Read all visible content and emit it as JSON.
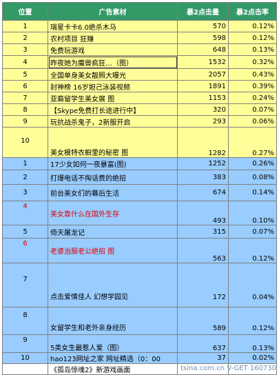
{
  "headers": [
    "位置",
    "广告素材",
    "暴2点击量",
    "暴2点击率"
  ],
  "rows": [
    {
      "pos": "1",
      "ad": "瑞星卡卡6.0绝杀木马",
      "clicks": "570",
      "rate": "0.12%",
      "group": "y"
    },
    {
      "pos": "2",
      "ad": "农村项目 狂赚",
      "clicks": "598",
      "rate": "0.12%",
      "group": "y"
    },
    {
      "pos": "3",
      "ad": "免费玩游戏",
      "clicks": "648",
      "rate": "0.13%",
      "group": "y"
    },
    {
      "pos": "4",
      "ad": "昨夜她为魔兽疯狂…（图）",
      "clicks": "1532",
      "rate": "0.32%",
      "group": "y"
    },
    {
      "pos": "5",
      "ad": "全国单身美女靓照大曝光",
      "clicks": "2057",
      "rate": "0.43%",
      "group": "y"
    },
    {
      "pos": "6",
      "ad": "封神榜 16岁妲己泳装视频",
      "clicks": "1891",
      "rate": "0.39%",
      "group": "y"
    },
    {
      "pos": "7",
      "ad": "亚裔留学生美女展 图",
      "clicks": "1153",
      "rate": "0.24%",
      "group": "y"
    },
    {
      "pos": "8",
      "ad": "【Skype免费打长途进行中】",
      "clicks": "320",
      "rate": "0.07%",
      "group": "y"
    },
    {
      "pos": "9",
      "ad": "玩抗战杀鬼子，2新服开启",
      "clicks": "293",
      "rate": "0.06%",
      "group": "y"
    },
    {
      "pos": "10",
      "ad": "美女模特衣橱里的秘密 图",
      "clicks": "1282",
      "rate": "0.27%",
      "group": "y"
    },
    {
      "pos": "1",
      "ad": "17少女如何一夜暴富(图)",
      "clicks": "1252",
      "rate": "0.26%",
      "group": "b"
    },
    {
      "pos": "2",
      "ad": "打爆电话不掏话费的绝招",
      "clicks": "383",
      "rate": "0.08%",
      "group": "b"
    },
    {
      "pos": "3",
      "ad": "前台美女们的幕后生活",
      "clicks": "674",
      "rate": "0.14%",
      "group": "b"
    },
    {
      "pos": "4",
      "ad": "美女靠什么在国外生存",
      "clicks": "493",
      "rate": "0.10%",
      "group": "b"
    },
    {
      "pos": "5",
      "ad": "倚天屠龙记",
      "clicks": "315",
      "rate": "0.07%",
      "group": "b"
    },
    {
      "pos": "6",
      "ad": "老婆治服老公绝招 图",
      "clicks": "563",
      "rate": "0.12%",
      "group": "b"
    },
    {
      "pos": "7",
      "ad": "点击爱情佳人 幻想学园见",
      "clicks": "172",
      "rate": "0.04%",
      "group": "b"
    },
    {
      "pos": "8",
      "ad": "女留学生和老外亲身经历",
      "clicks": "589",
      "rate": "0.12%",
      "group": "b"
    },
    {
      "pos": "9",
      "ad": "5类女生最惹人爱（图）",
      "clicks": "637",
      "rate": "0.13%",
      "group": "b"
    },
    {
      "pos": "10",
      "ad": "hao123网址之家 网址精选（0：00",
      "clicks": "37",
      "rate": "0.02%",
      "group": "b"
    },
    {
      "pos": "",
      "ad": "《孤岛惊魂2》新游戏画面",
      "clicks": "",
      "rate": "",
      "group": "w"
    }
  ],
  "watermark": "tsina.com.cn  V-GET 160730",
  "colors": {
    "header_bg": "#339966",
    "yellow": "#ffff99",
    "blue": "#99ccff",
    "red": "#e00000"
  }
}
